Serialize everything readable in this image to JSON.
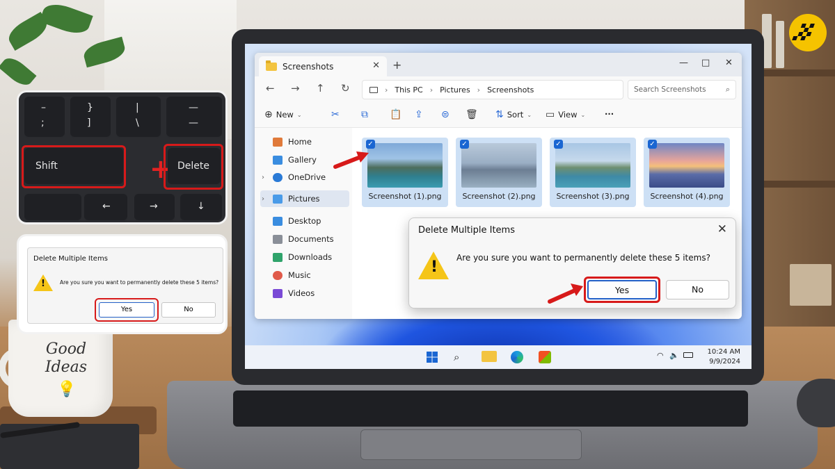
{
  "explorer": {
    "tab_title": "Screenshots",
    "tab_close": "✕",
    "new_tab": "+",
    "window_controls": [
      "—",
      "□",
      "✕"
    ],
    "nav": [
      "←",
      "→",
      "↑",
      "↻"
    ],
    "breadcrumb": [
      "This PC",
      "Pictures",
      "Screenshots"
    ],
    "breadcrumb_sep": "›",
    "search_placeholder": "Search Screenshots",
    "toolbar": {
      "new_label": "New",
      "sort_label": "Sort",
      "view_label": "View",
      "more": "···"
    },
    "sidebar": [
      {
        "label": "Home",
        "color": "#e07a3a"
      },
      {
        "label": "Gallery",
        "color": "#3a8de0"
      },
      {
        "label": "OneDrive",
        "color": "#2a7ad6"
      },
      {
        "label": "Pictures",
        "color": "#4a9be8"
      },
      {
        "label": "Desktop",
        "color": "#3a8de0"
      },
      {
        "label": "Documents",
        "color": "#8a8f98"
      },
      {
        "label": "Downloads",
        "color": "#2fa36b"
      },
      {
        "label": "Music",
        "color": "#e05a4a"
      },
      {
        "label": "Videos",
        "color": "#7a4ad6"
      }
    ],
    "files": [
      {
        "name": "Screenshot (1).png",
        "checked": true
      },
      {
        "name": "Screenshot (2).png",
        "checked": true
      },
      {
        "name": "Screenshot (3).png",
        "checked": true
      },
      {
        "name": "Screenshot (4).png",
        "checked": true
      }
    ]
  },
  "dialog": {
    "title": "Delete Multiple Items",
    "message": "Are you sure you want to permanently delete these 5 items?",
    "yes_label": "Yes",
    "no_label": "No",
    "close": "✕"
  },
  "taskbar": {
    "time": "10:24 AM",
    "date": "9/9/2024"
  },
  "keyboard_inset": {
    "shift_label": "Shift",
    "delete_label": "Delete",
    "plus": "+"
  },
  "dialog_inset": {
    "title": "Delete Multiple Items",
    "message": "Are you sure you want to permanently delete these 5 items?",
    "yes_label": "Yes",
    "no_label": "No"
  },
  "mug_text": "Good Ideas",
  "colors": {
    "accent_red": "#d71a1a",
    "windows_blue": "#1a66d2",
    "warning_yellow": "#f5c518",
    "logo_yellow": "#f5c300"
  }
}
